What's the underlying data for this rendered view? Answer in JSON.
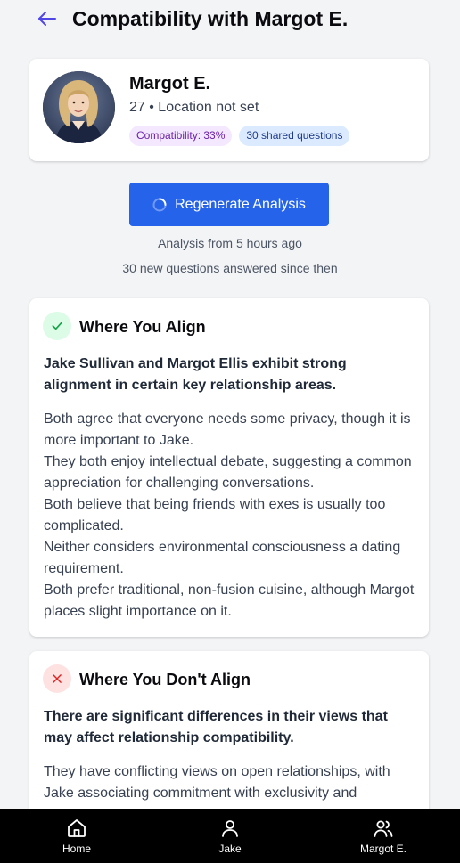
{
  "header": {
    "title": "Compatibility with Margot E."
  },
  "profile": {
    "name": "Margot E.",
    "meta": "27 • Location not set",
    "compatibility_badge": "Compatibility: 33%",
    "shared_badge": "30 shared questions"
  },
  "analysis": {
    "button_label": "Regenerate Analysis",
    "age_text": "Analysis from 5 hours ago",
    "new_answers_text": "30 new questions answered since then"
  },
  "align_section": {
    "title": "Where You Align",
    "summary": "Jake Sullivan and Margot Ellis exhibit strong alignment in certain key relationship areas.",
    "points": [
      "Both agree that everyone needs some privacy, though it is more important to Jake.",
      "They both enjoy intellectual debate, suggesting a common appreciation for challenging conversations.",
      "Both believe that being friends with exes is usually too complicated.",
      "Neither considers environmental consciousness a dating requirement.",
      "Both prefer traditional, non-fusion cuisine, although Margot places slight importance on it."
    ]
  },
  "misalign_section": {
    "title": "Where You Don't Align",
    "summary": "There are significant differences in their views that may affect relationship compatibility.",
    "points": [
      "They have conflicting views on open relationships, with Jake associating commitment with exclusivity and"
    ]
  },
  "nav": {
    "items": [
      {
        "label": "Home",
        "icon": "home-icon"
      },
      {
        "label": "Jake",
        "icon": "user-icon"
      },
      {
        "label": "Margot E.",
        "icon": "users-icon"
      }
    ]
  },
  "colors": {
    "accent": "#2563eb",
    "back_arrow": "#4f46e5",
    "align_icon": "#16a34a",
    "misalign_icon": "#dc2626"
  }
}
